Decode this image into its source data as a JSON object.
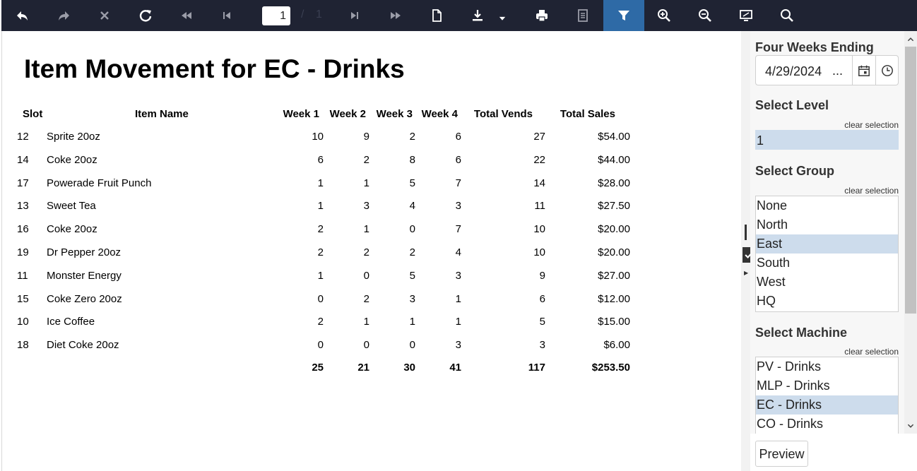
{
  "toolbar": {
    "current_page": "1",
    "page_separator": "/",
    "total_pages": "1"
  },
  "report": {
    "title": "Item Movement for EC - Drinks",
    "columns": [
      "Slot",
      "Item Name",
      "Week 1",
      "Week 2",
      "Week 3",
      "Week 4",
      "Total Vends",
      "Total Sales"
    ],
    "rows": [
      [
        "12",
        "Sprite 20oz",
        "10",
        "9",
        "2",
        "6",
        "27",
        "$54.00"
      ],
      [
        "14",
        "Coke 20oz",
        "6",
        "2",
        "8",
        "6",
        "22",
        "$44.00"
      ],
      [
        "17",
        "Powerade Fruit Punch",
        "1",
        "1",
        "5",
        "7",
        "14",
        "$28.00"
      ],
      [
        "13",
        "Sweet Tea",
        "1",
        "3",
        "4",
        "3",
        "11",
        "$27.50"
      ],
      [
        "16",
        "Coke 20oz",
        "2",
        "1",
        "0",
        "7",
        "10",
        "$20.00"
      ],
      [
        "19",
        "Dr Pepper 20oz",
        "2",
        "2",
        "2",
        "4",
        "10",
        "$20.00"
      ],
      [
        "11",
        "Monster Energy",
        "1",
        "0",
        "5",
        "3",
        "9",
        "$27.00"
      ],
      [
        "15",
        "Coke Zero 20oz",
        "0",
        "2",
        "3",
        "1",
        "6",
        "$12.00"
      ],
      [
        "10",
        "Ice Coffee",
        "2",
        "1",
        "1",
        "1",
        "5",
        "$15.00"
      ],
      [
        "18",
        "Diet Coke 20oz",
        "0",
        "0",
        "0",
        "3",
        "3",
        "$6.00"
      ]
    ],
    "totals": [
      "25",
      "21",
      "30",
      "41",
      "117",
      "$253.50"
    ]
  },
  "params": {
    "date_label": "Four Weeks Ending",
    "date_value": "4/29/2024",
    "date_ellipsis": "...",
    "level_label": "Select Level",
    "level_value": "1",
    "group_label": "Select Group",
    "groups": [
      "None",
      "North",
      "East",
      "South",
      "West",
      "HQ"
    ],
    "selected_group": "East",
    "machine_label": "Select Machine",
    "machines": [
      "PV - Drinks",
      "MLP - Drinks",
      "EC - Drinks",
      "CO - Drinks"
    ],
    "selected_machine": "EC - Drinks",
    "clear_label": "clear selection",
    "preview_label": "Preview"
  },
  "colors": {
    "toolbar_bg": "#1f2333",
    "toolbar_active": "#2e6aa6",
    "selection": "#cddcec"
  },
  "icons": [
    "undo-icon",
    "redo-icon",
    "stop-icon",
    "refresh-icon",
    "first-page-icon",
    "prev-page-icon",
    "next-page-icon",
    "last-page-icon",
    "document-icon",
    "download-icon",
    "dropdown-arrow-icon",
    "print-icon",
    "print-page-icon",
    "filter-icon",
    "zoom-in-icon",
    "zoom-out-icon",
    "fullscreen-icon",
    "search-icon",
    "calendar-icon",
    "clock-icon"
  ]
}
